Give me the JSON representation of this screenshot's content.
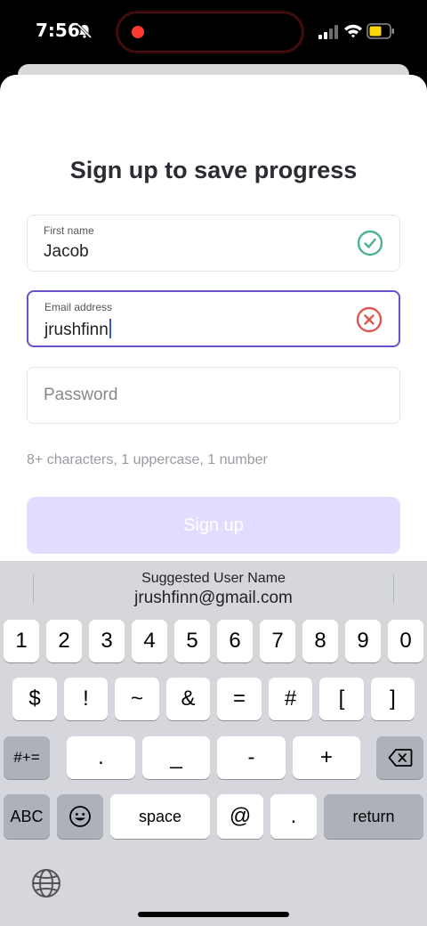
{
  "status_bar": {
    "time": "7:56",
    "icons": [
      "bell-slash-icon",
      "record-dot-icon",
      "cellular-signal-icon",
      "wifi-icon",
      "battery-icon"
    ],
    "record_color": "#ff3b30",
    "battery_color": "#ffd60a"
  },
  "form": {
    "title": "Sign up to save progress",
    "first_name": {
      "label": "First name",
      "value": "Jacob",
      "status_icon": "check-circle-icon",
      "status_color": "#4cb38a"
    },
    "email": {
      "label": "Email address",
      "value": "jrushfinn",
      "status_icon": "error-circle-icon",
      "status_color": "#e0574f",
      "border_color": "#6b4ec9"
    },
    "password": {
      "placeholder": "Password"
    },
    "hint": "8+ characters, 1 uppercase, 1 number",
    "submit_label": "Sign up",
    "submit_color": "#e2dcff"
  },
  "keyboard": {
    "suggestion_title": "Suggested User Name",
    "suggestion_value": "jrushfinn@gmail.com",
    "row1": [
      "1",
      "2",
      "3",
      "4",
      "5",
      "6",
      "7",
      "8",
      "9",
      "0"
    ],
    "row2": [
      "$",
      "!",
      "~",
      "&",
      "=",
      "#",
      "[",
      "]"
    ],
    "row3_left": "#+=",
    "row3": [
      ".",
      "_",
      "-",
      "+"
    ],
    "row4_left": "ABC",
    "space": "space",
    "at": "@",
    "dot": ".",
    "return": "return",
    "icons": [
      "backspace-icon",
      "emoji-icon",
      "globe-icon"
    ]
  }
}
